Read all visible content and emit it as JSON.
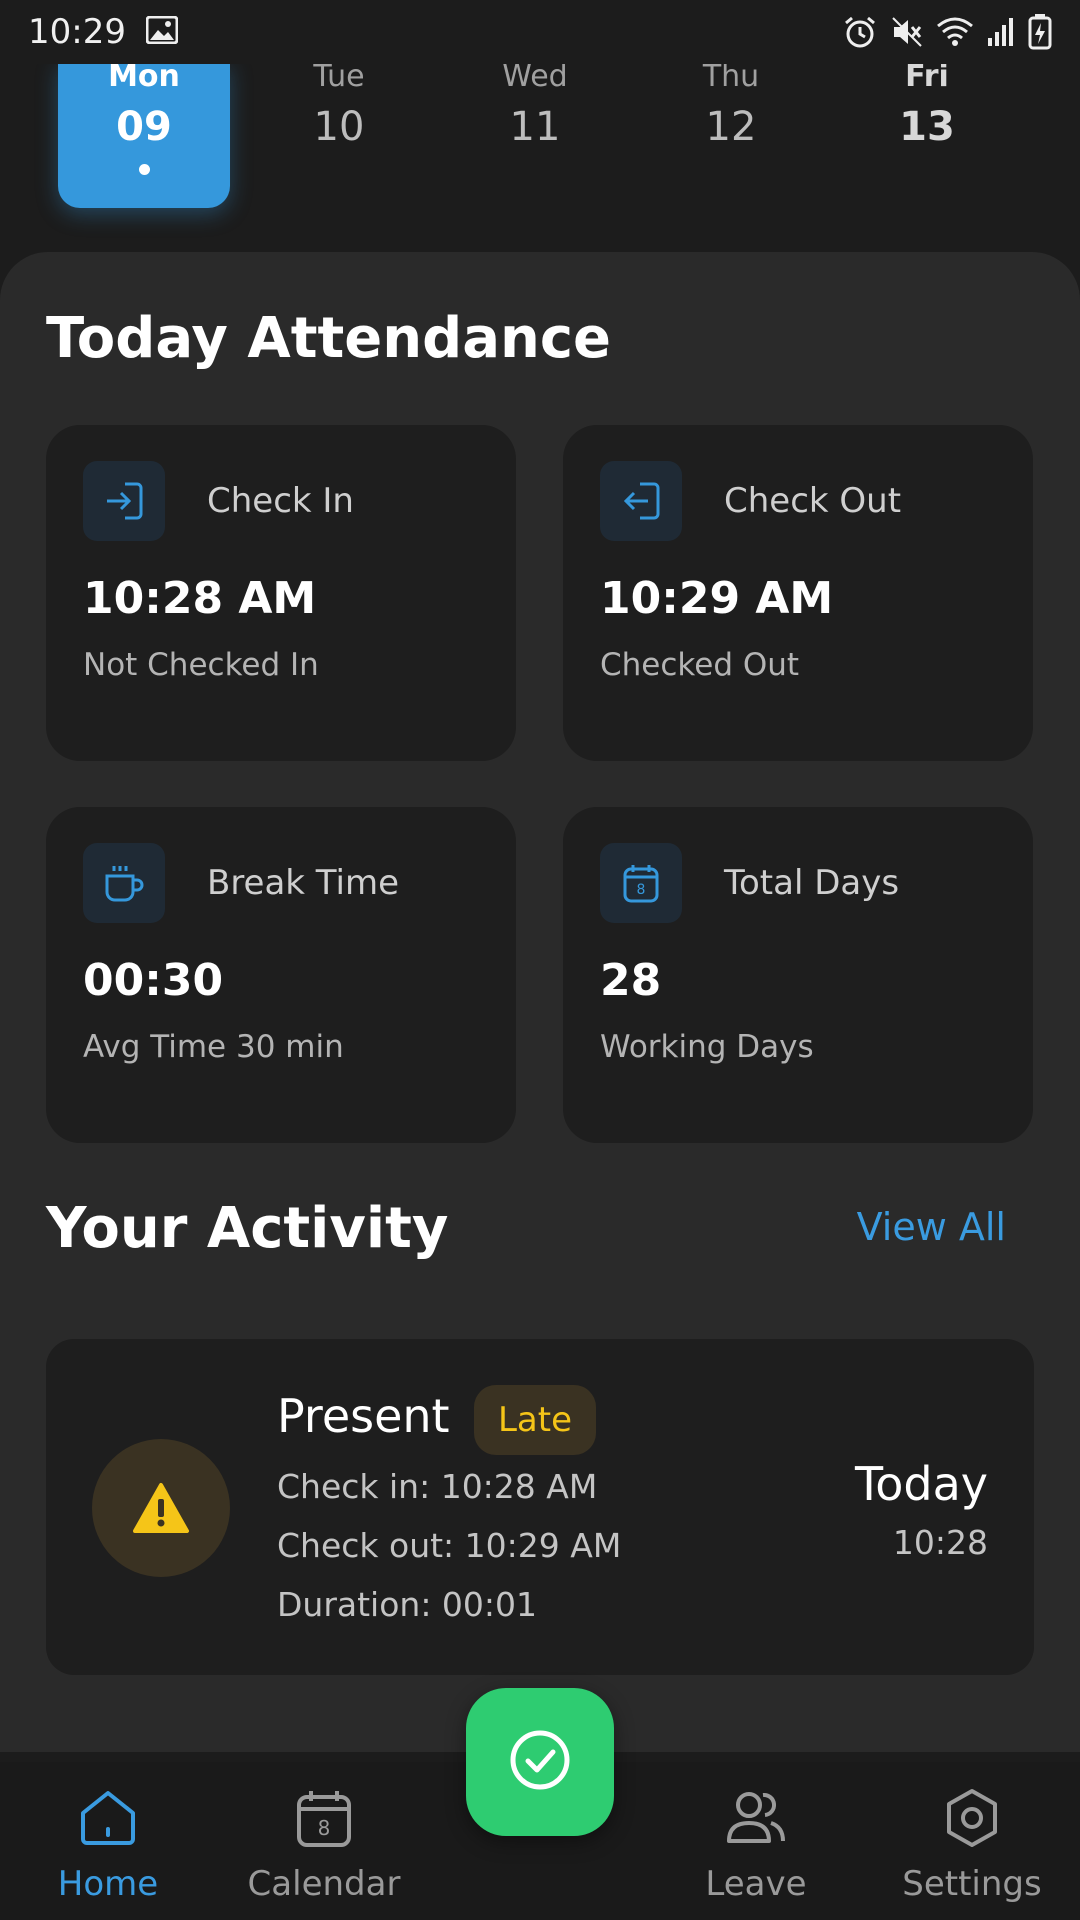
{
  "status_bar": {
    "time": "10:29"
  },
  "week": {
    "days": [
      {
        "name": "Mon",
        "num": "09"
      },
      {
        "name": "Tue",
        "num": "10"
      },
      {
        "name": "Wed",
        "num": "11"
      },
      {
        "name": "Thu",
        "num": "12"
      },
      {
        "name": "Fri",
        "num": "13"
      }
    ],
    "selected_day": "Mon"
  },
  "attendance": {
    "title": "Today Attendance",
    "check_in": {
      "label": "Check In",
      "value": "10:28 AM",
      "sub": "Not Checked In",
      "icon": "login-icon"
    },
    "check_out": {
      "label": "Check Out",
      "value": "10:29 AM",
      "sub": "Checked Out",
      "icon": "logout-icon"
    },
    "break_time": {
      "label": "Break Time",
      "value": "00:30",
      "sub": "Avg Time 30 min",
      "icon": "coffee-icon"
    },
    "total_days": {
      "label": "Total Days",
      "value": "28",
      "sub": "Working Days",
      "icon": "calendar-icon"
    }
  },
  "activity": {
    "title": "Your Activity",
    "view_all": "View All",
    "items": [
      {
        "status": "Present",
        "badge": "Late",
        "check_in": "Check in: 10:28 AM",
        "check_out": "Check out: 10:29 AM",
        "duration": "Duration: 00:01",
        "day": "Today",
        "time": "10:28",
        "icon": "warning-icon"
      }
    ]
  },
  "nav": {
    "items": [
      {
        "label": "Home",
        "icon": "home-icon",
        "active": true
      },
      {
        "label": "Calendar",
        "icon": "calendar-icon"
      },
      {
        "label": "Leave",
        "icon": "users-icon"
      },
      {
        "label": "Settings",
        "icon": "settings-icon"
      }
    ],
    "fab_icon": "check-circle-icon"
  },
  "colors": {
    "accent": "#3598dc",
    "warning": "#f5c518",
    "success": "#2ecc71",
    "background": "#1c1c1c",
    "panel": "#2a2a2a",
    "card": "#1e1e1e"
  }
}
